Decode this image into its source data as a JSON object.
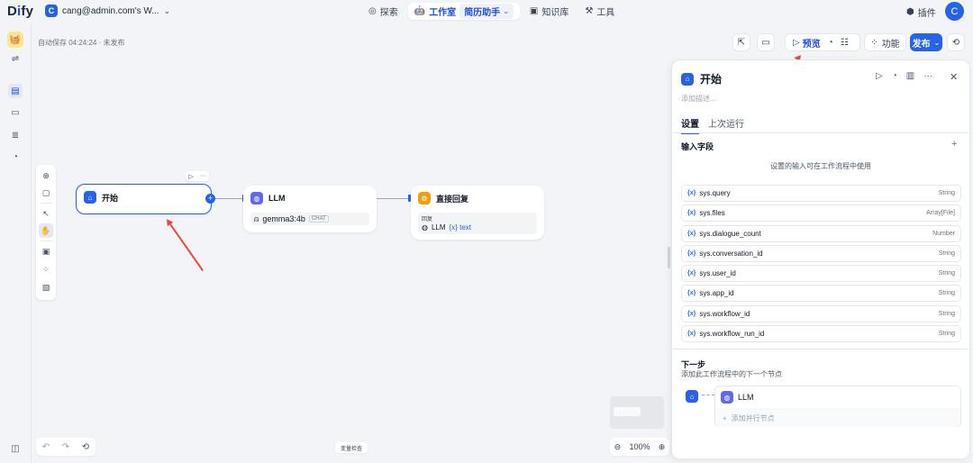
{
  "header": {
    "logo_text": "D",
    "logo_i": "i",
    "logo_rest": "fy",
    "workspace_initial": "C",
    "workspace_name": "cang@admin.com's W...",
    "nav": {
      "explore": "探索",
      "studio": "工作室",
      "current_app": "简历助手",
      "knowledge": "知识库",
      "tools": "工具"
    },
    "plugins": "插件",
    "avatar_initial": "C"
  },
  "canvas": {
    "autosave": "自动保存 04:24:24 · 未发布",
    "nodes": {
      "start": {
        "title": "开始"
      },
      "llm": {
        "title": "LLM",
        "model": "gemma3:4b",
        "model_tag": "CHAT"
      },
      "answer": {
        "title": "直接回复",
        "reply_label": "回复",
        "ref_node": "LLM",
        "ref_var": "{x} text"
      }
    },
    "var_check": "变量检查",
    "zoom": "100%"
  },
  "actions": {
    "preview": "预览",
    "features": "功能",
    "publish": "发布"
  },
  "panel": {
    "title": "开始",
    "description_placeholder": "添加描述...",
    "tabs": {
      "settings": "设置",
      "last_run": "上次运行"
    },
    "input_fields": "输入字段",
    "hint": "设置的输入可在工作流程中使用",
    "vars": [
      {
        "name": "sys.query",
        "type": "String"
      },
      {
        "name": "sys.files",
        "type": "Array[File]"
      },
      {
        "name": "sys.dialogue_count",
        "type": "Number"
      },
      {
        "name": "sys.conversation_id",
        "type": "String"
      },
      {
        "name": "sys.user_id",
        "type": "String"
      },
      {
        "name": "sys.app_id",
        "type": "String"
      },
      {
        "name": "sys.workflow_id",
        "type": "String"
      },
      {
        "name": "sys.workflow_run_id",
        "type": "String"
      }
    ],
    "next_step": "下一步",
    "next_step_desc": "添加此工作流程中的下一个节点",
    "next_node": "LLM",
    "add_parallel": "添加并行节点",
    "var_brace": "{x}"
  },
  "colors": {
    "accent": "#2563eb",
    "annotation": "#ef4444"
  }
}
